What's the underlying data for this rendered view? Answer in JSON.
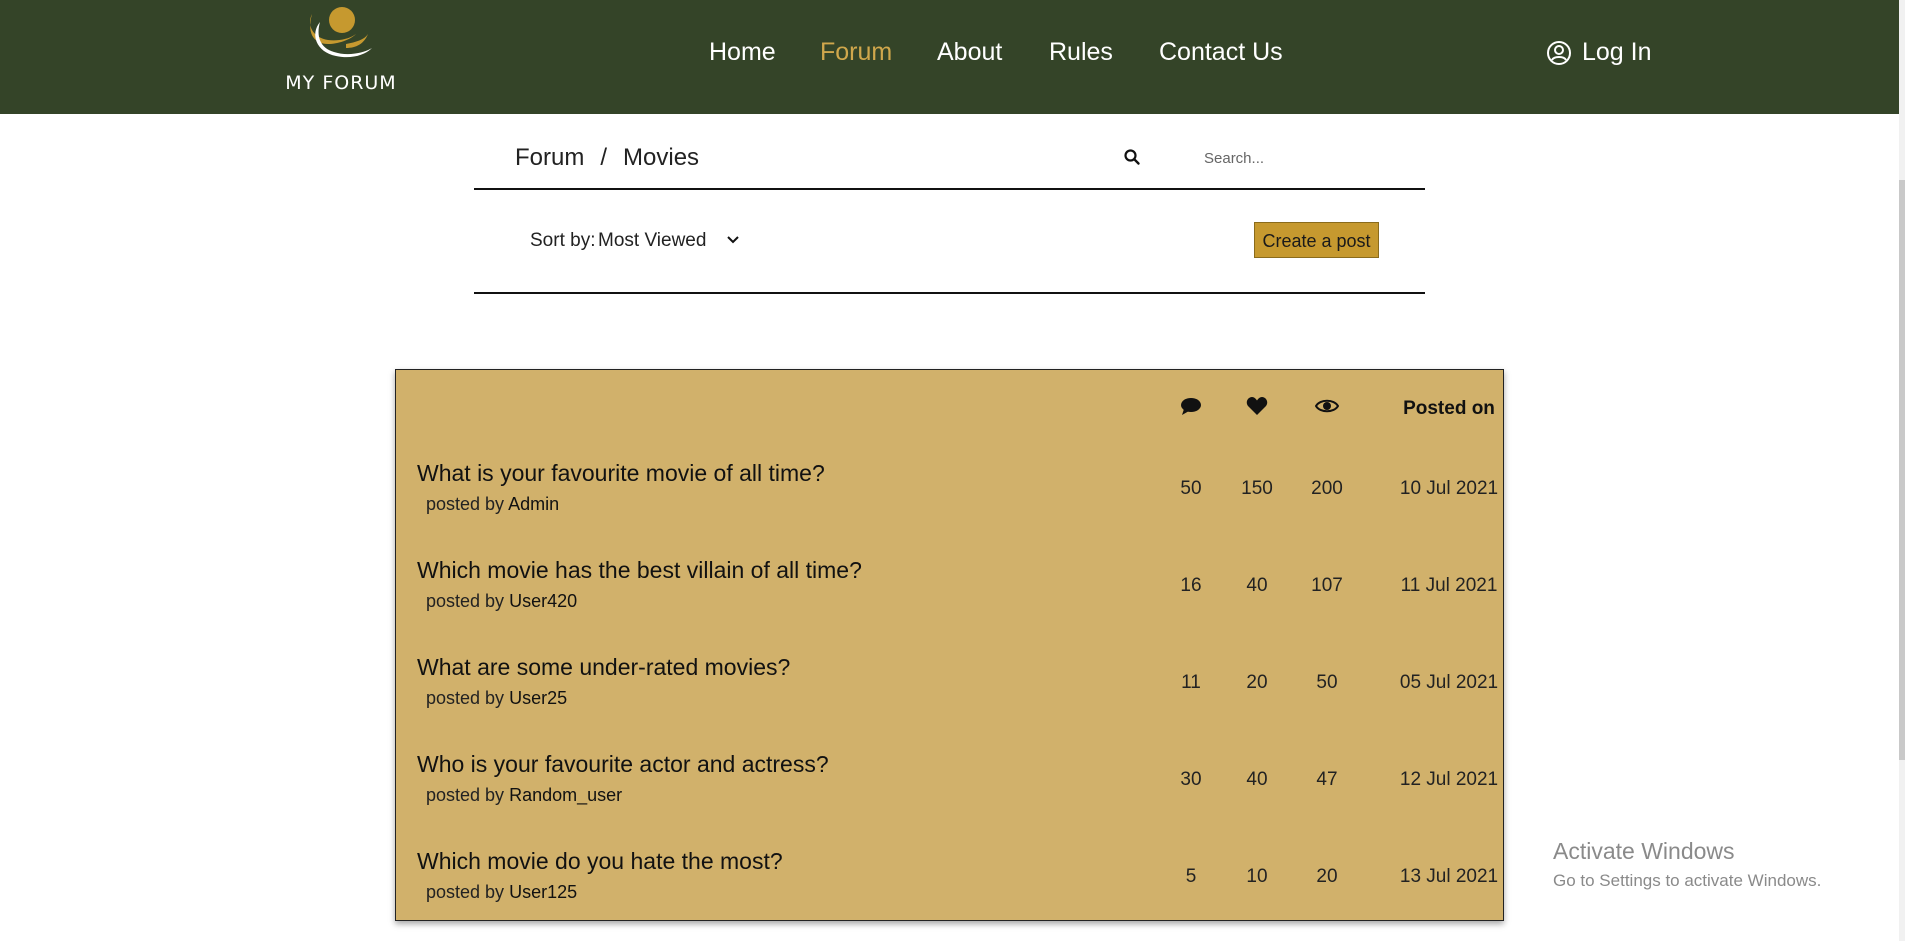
{
  "header": {
    "logo_text": "MY FORUM",
    "nav": [
      {
        "label": "Home",
        "active": false
      },
      {
        "label": "Forum",
        "active": true
      },
      {
        "label": "About",
        "active": false
      },
      {
        "label": "Rules",
        "active": false
      },
      {
        "label": "Contact Us",
        "active": false
      }
    ],
    "login_label": "Log In"
  },
  "breadcrumb": {
    "root": "Forum",
    "separator": "/",
    "current": "Movies"
  },
  "search": {
    "placeholder": "Search..."
  },
  "sort": {
    "label": "Sort by:",
    "selected": "Most Viewed"
  },
  "create_post_label": "Create a post",
  "table": {
    "posted_on_header": "Posted on",
    "posted_by_prefix": "posted by",
    "rows": [
      {
        "title": "What is your favourite movie of all time?",
        "author": "Admin",
        "comments": "50",
        "likes": "150",
        "views": "200",
        "date": "10 Jul 2021"
      },
      {
        "title": "Which movie has the best villain of all time?",
        "author": "User420",
        "comments": "16",
        "likes": "40",
        "views": "107",
        "date": "11 Jul 2021"
      },
      {
        "title": "What are some under-rated movies?",
        "author": "User25",
        "comments": "11",
        "likes": "20",
        "views": "50",
        "date": "05 Jul 2021"
      },
      {
        "title": "Who is your favourite actor and actress?",
        "author": "Random_user",
        "comments": "30",
        "likes": "40",
        "views": "47",
        "date": "12 Jul 2021"
      },
      {
        "title": "Which movie do you hate the most?",
        "author": "User125",
        "comments": "5",
        "likes": "10",
        "views": "20",
        "date": "13 Jul 2021"
      }
    ]
  },
  "watermark": {
    "line1": "Activate Windows",
    "line2": "Go to Settings to activate Windows."
  },
  "colors": {
    "header_bg": "#344428",
    "accent": "#d0a74c",
    "table_bg": "#d1b16b",
    "button_bg": "#c6992f"
  }
}
